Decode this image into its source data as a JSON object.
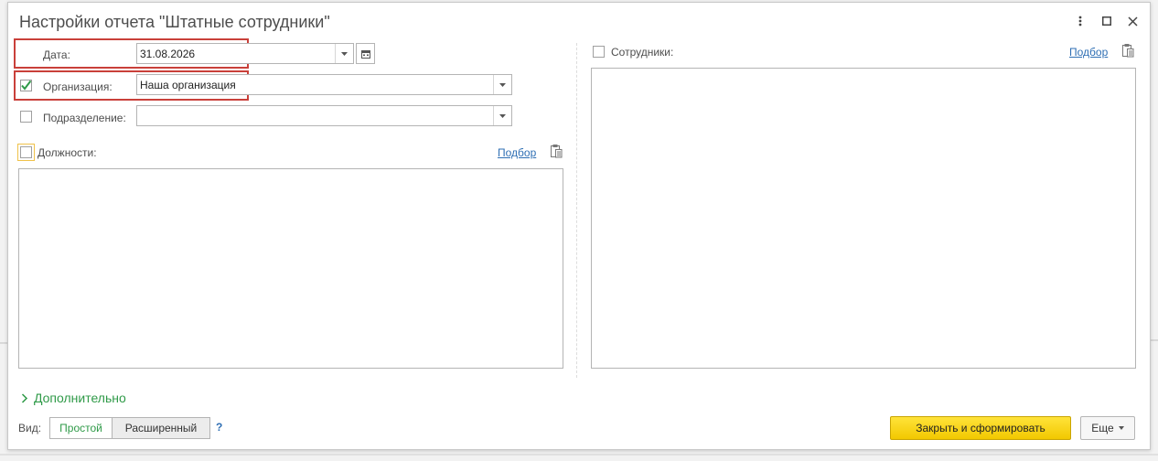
{
  "window": {
    "title": "Настройки отчета \"Штатные сотрудники\""
  },
  "form": {
    "date": {
      "label": "Дата:",
      "value": "31.08.2026"
    },
    "organization": {
      "label": "Организация:",
      "value": "Наша организация",
      "checked": true
    },
    "department": {
      "label": "Подразделение:",
      "value": "",
      "checked": false
    },
    "positions": {
      "label": "Должности:",
      "pick_label": "Подбор",
      "checked": false
    },
    "employees": {
      "label": "Сотрудники:",
      "pick_label": "Подбор",
      "checked": false
    }
  },
  "footer": {
    "more_section": "Дополнительно",
    "view_label": "Вид:",
    "view_options": [
      "Простой",
      "Расширенный"
    ],
    "view_selected": "Простой",
    "help": "?",
    "primary_button": "Закрыть и сформировать",
    "more_button": "Еще"
  },
  "colors": {
    "highlight": "#c9403a",
    "check_green": "#2f9a48",
    "link_blue": "#2f6fb4",
    "primary_yellow": "#f2c800"
  }
}
